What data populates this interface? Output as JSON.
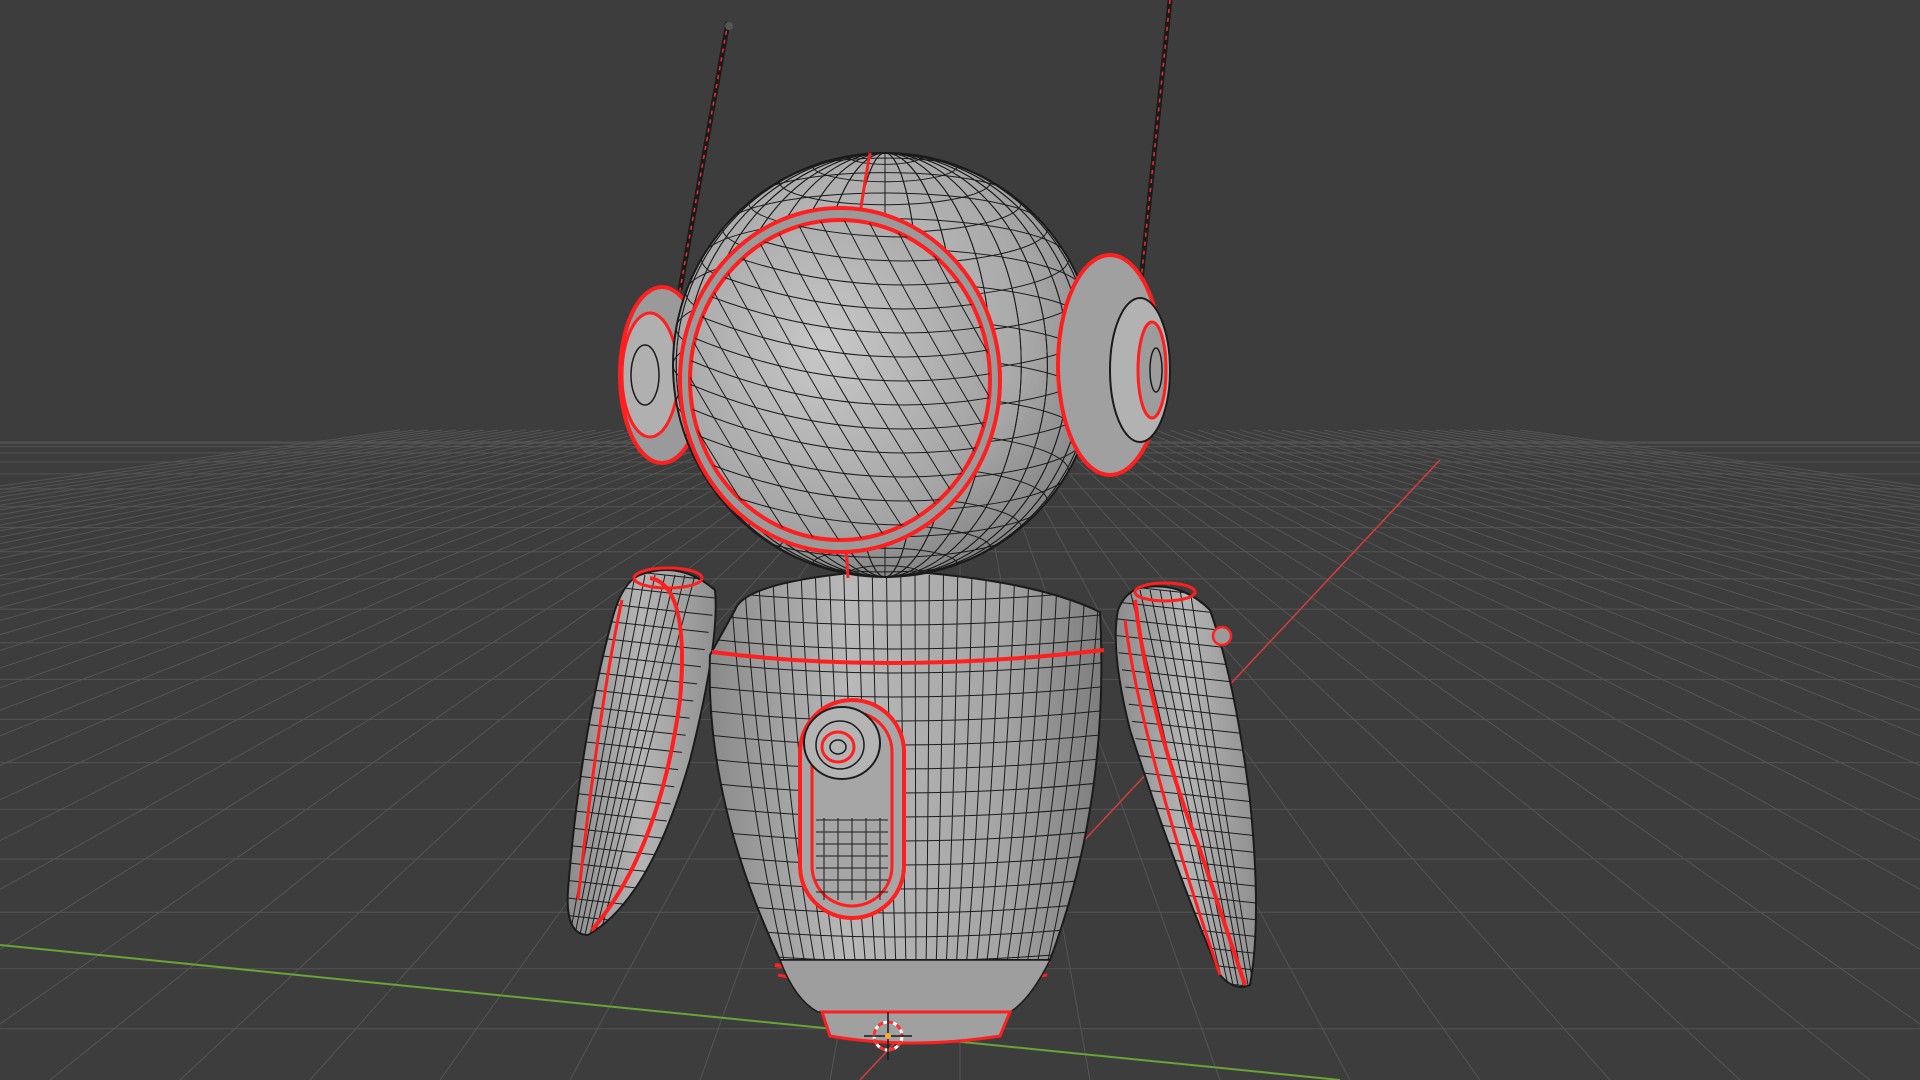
{
  "viewport": {
    "mode": "3d-viewport-edit-mode",
    "background_color": "#3d3d3d",
    "grid_color": "#545454",
    "x_axis_color": "#d63c3c",
    "y_axis_color": "#6aa336"
  },
  "mesh": {
    "surface_color": "#a9a9a9",
    "wire_color": "#1b1b1b",
    "seam_color": "#ff1f1f",
    "parts": [
      "head",
      "visor",
      "left-ear",
      "right-ear",
      "antenna-left",
      "antenna-right",
      "body",
      "chest-panel",
      "chest-button",
      "left-arm",
      "right-arm",
      "base-ring",
      "base-foot"
    ]
  },
  "cursor_3d": {
    "icon": "3d-cursor-icon"
  }
}
